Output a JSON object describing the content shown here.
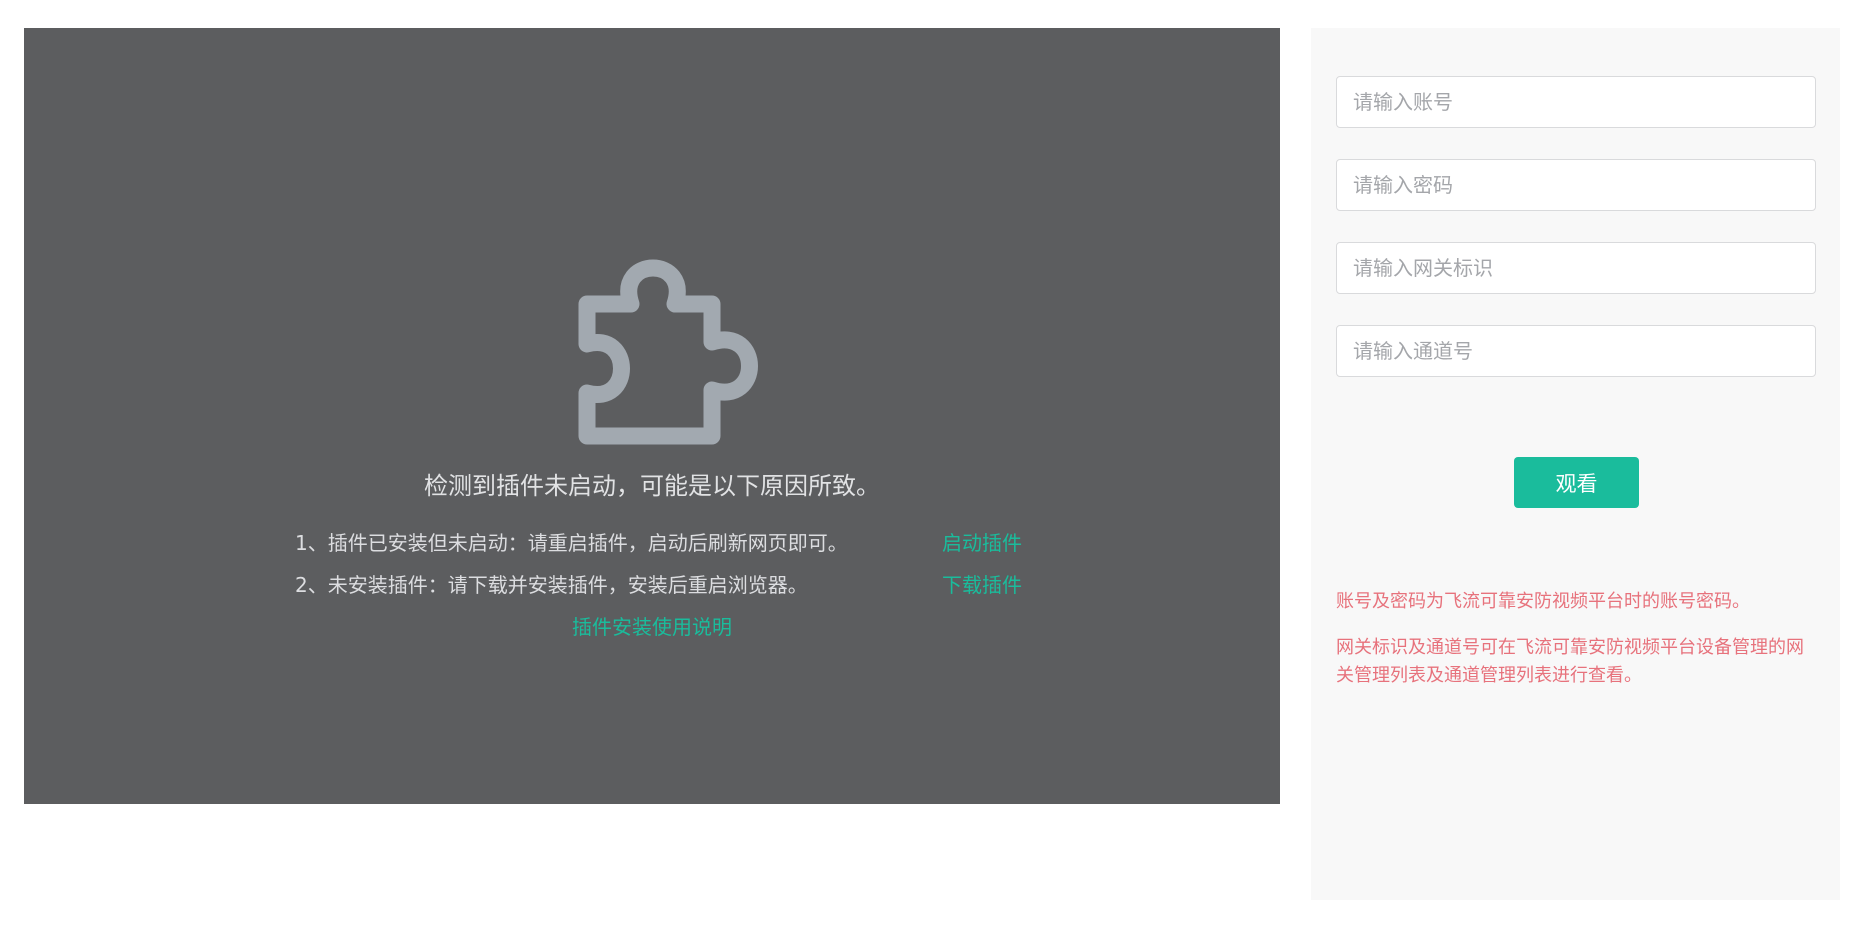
{
  "plugin": {
    "icon": "puzzle-icon",
    "headline": "检测到插件未启动，可能是以下原因所致。",
    "reasons": [
      {
        "text": "1、插件已安装但未启动：请重启插件，启动后刷新网页即可。",
        "link": "启动插件"
      },
      {
        "text": "2、未安装插件：请下载并安装插件，安装后重启浏览器。",
        "link": "下载插件"
      }
    ],
    "guide_link": "插件安装使用说明"
  },
  "form": {
    "account_placeholder": "请输入账号",
    "password_placeholder": "请输入密码",
    "gateway_placeholder": "请输入网关标识",
    "channel_placeholder": "请输入通道号",
    "watch_label": "观看",
    "notes": [
      "账号及密码为飞流可靠安防视频平台时的账号密码。",
      "网关标识及通道号可在飞流可靠安防视频平台设备管理的网关管理列表及通道管理列表进行查看。"
    ]
  },
  "colors": {
    "panel_bg": "#5c5d5f",
    "accent": "#1abc9c",
    "note": "#e7727c",
    "icon": "#a2a9b0"
  }
}
